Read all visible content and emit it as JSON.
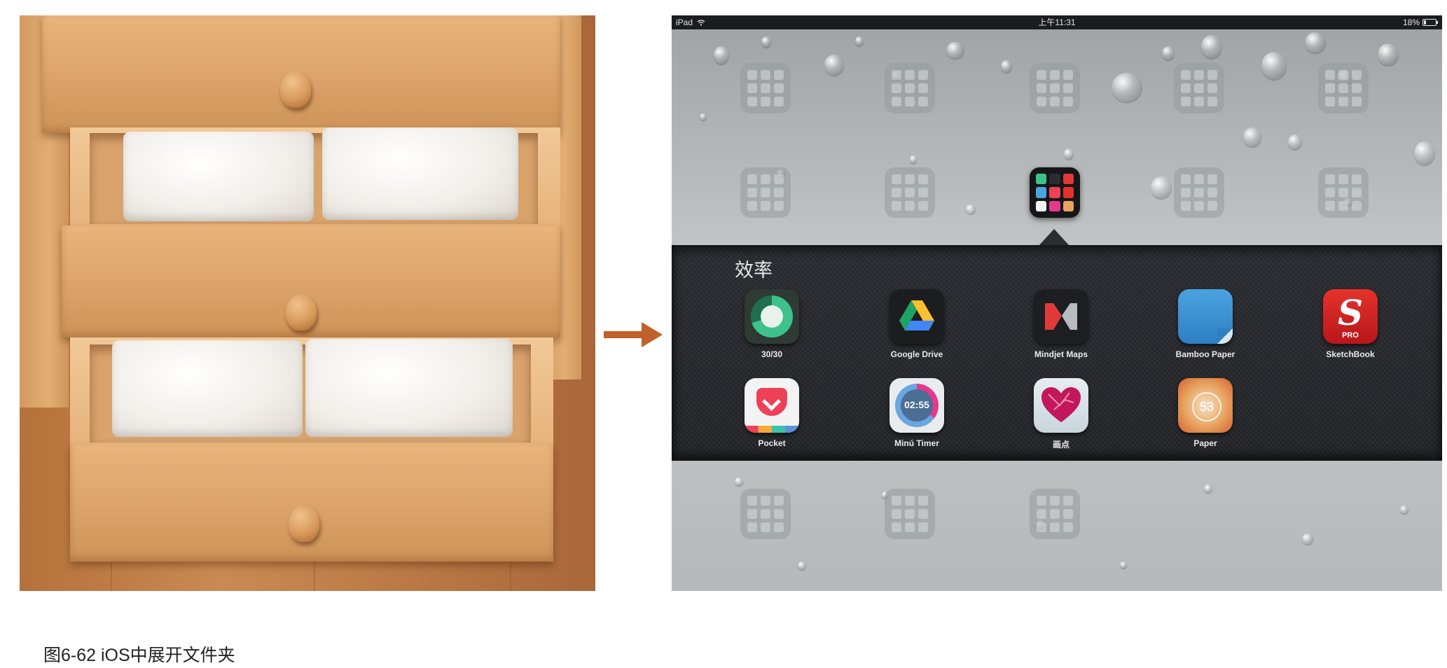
{
  "caption": "图6-62 iOS中展开文件夹",
  "ipad": {
    "status_bar": {
      "device": "iPad",
      "time": "上午11:31",
      "battery": "18%",
      "wifi_icon": "wifi-icon",
      "battery_icon": "battery-icon"
    },
    "folder": {
      "name": "效率",
      "apps": [
        {
          "label": "30/30"
        },
        {
          "label": "Google Drive"
        },
        {
          "label": "Mindjet Maps"
        },
        {
          "label": "Bamboo Paper"
        },
        {
          "label": "SketchBook"
        },
        {
          "label": "Pocket"
        },
        {
          "label": "Minú Timer"
        },
        {
          "label": "画点"
        },
        {
          "label": "Paper"
        }
      ]
    },
    "sketchbook_badge": "PRO",
    "minu_time": "02:55",
    "paper_number": "53"
  },
  "colors": {
    "arrow": "#c0602a",
    "panel": "#2a2c30",
    "statusbar": "#1b1c1e"
  }
}
